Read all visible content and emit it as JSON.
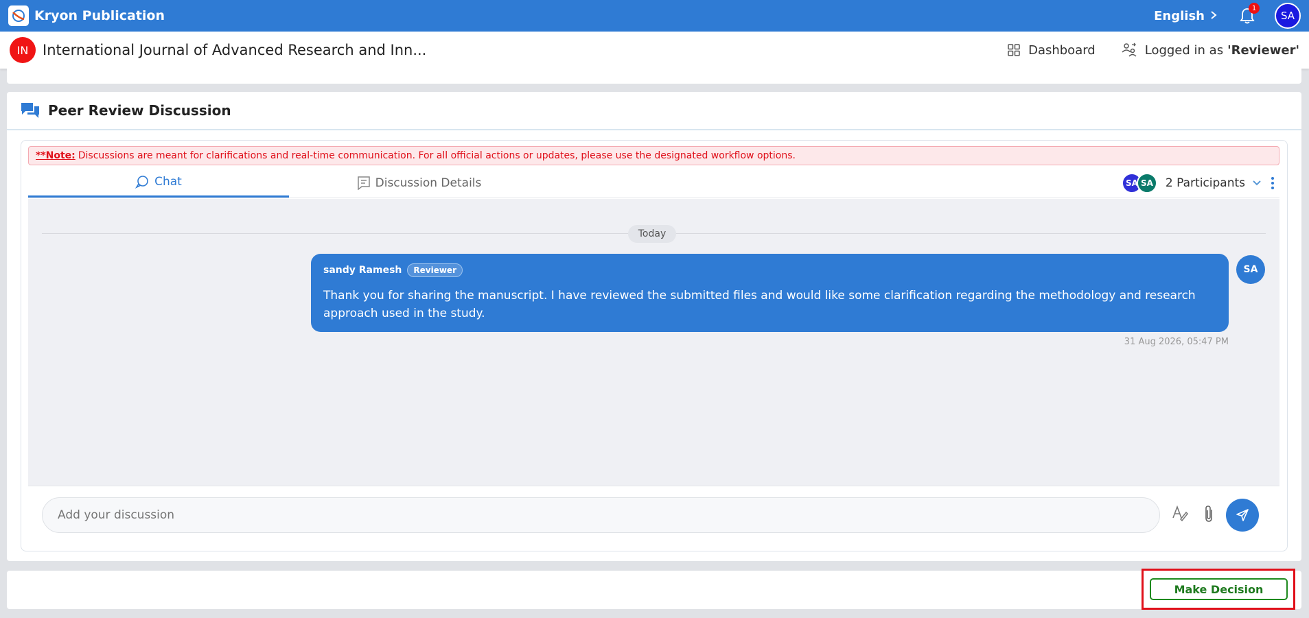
{
  "header": {
    "brand_name": "Kryon Publication",
    "language": "English",
    "notification_count": "1",
    "user_initials": "SA"
  },
  "journal": {
    "initials": "IN",
    "title": "International Journal of Advanced Research and Inn...",
    "dashboard_label": "Dashboard",
    "logged_in_prefix": "Logged in as",
    "logged_in_role": "'Reviewer'"
  },
  "panel": {
    "title": "Peer Review Discussion",
    "note_label": "**Note:",
    "note_text": "Discussions are meant for clarifications and real-time communication. For all official actions or updates, please use the designated workflow options.",
    "tabs": [
      {
        "label": "Chat",
        "active": true
      },
      {
        "label": "Discussion Details",
        "active": false
      }
    ],
    "participants": {
      "avatars": [
        "SA",
        "SA"
      ],
      "count_label": "2 Participants"
    }
  },
  "chat": {
    "date_divider": "Today",
    "messages": [
      {
        "sender": "sandy Ramesh",
        "role": "Reviewer",
        "text": "Thank you for sharing the manuscript. I have reviewed the submitted files and would like some clarification regarding the methodology and research approach used in the study.",
        "avatar": "SA",
        "timestamp": "31 Aug 2026, 05:47 PM"
      }
    ]
  },
  "composer": {
    "placeholder": "Add your discussion"
  },
  "footer": {
    "make_decision_label": "Make Decision"
  },
  "colors": {
    "primary": "#2f7bd4",
    "note_red": "#e0101a",
    "decision_green": "#1e8a1e"
  }
}
